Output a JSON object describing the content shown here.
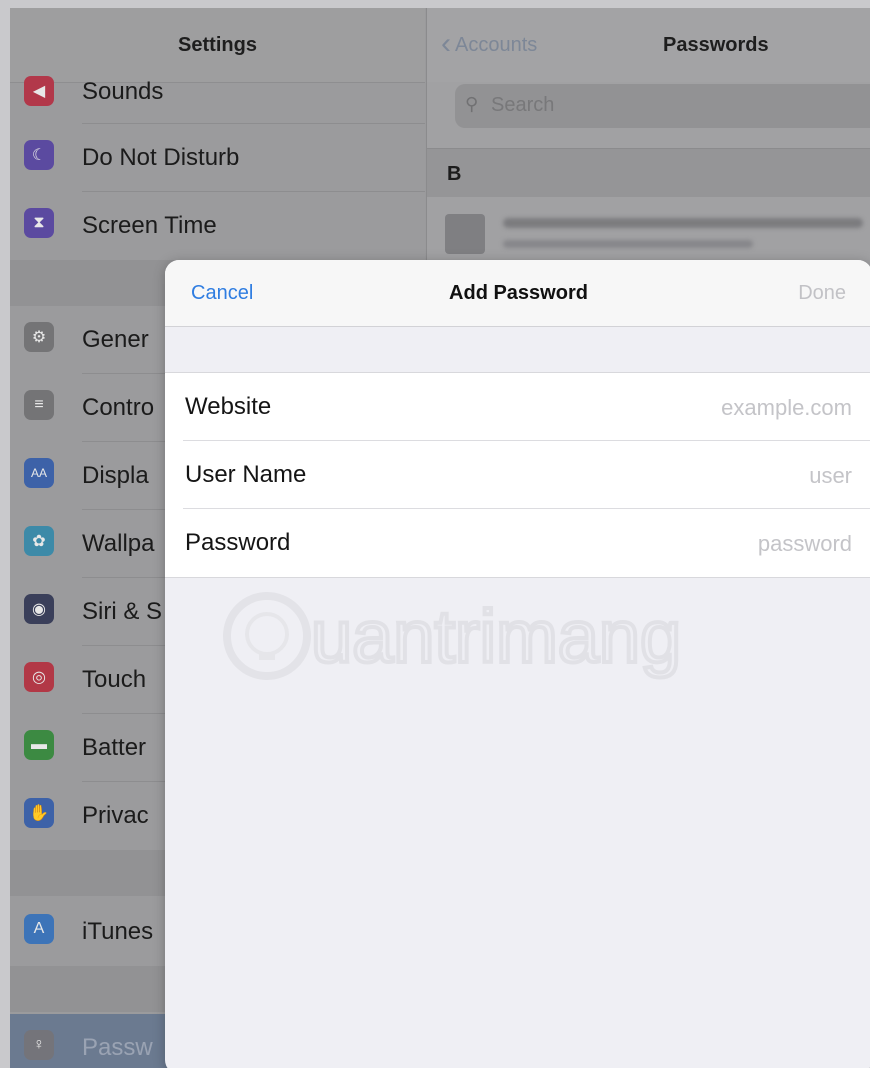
{
  "settings": {
    "title": "Settings",
    "items": [
      {
        "label": "Sounds",
        "icon": "speaker-icon",
        "color": "#b2384a",
        "glyph": "◀"
      },
      {
        "label": "Do Not Disturb",
        "icon": "moon-icon",
        "color": "#5b4aa0",
        "glyph": "☾"
      },
      {
        "label": "Screen Time",
        "icon": "hourglass-icon",
        "color": "#5b4aa0",
        "glyph": "⧗"
      },
      {
        "label": "Gener",
        "icon": "gear-icon",
        "color": "#747476",
        "glyph": "⚙"
      },
      {
        "label": "Contro",
        "icon": "toggles-icon",
        "color": "#747476",
        "glyph": "≡"
      },
      {
        "label": "Displa",
        "icon": "display-icon",
        "color": "#3d62a8",
        "glyph": "AA"
      },
      {
        "label": "Wallpa",
        "icon": "flower-icon",
        "color": "#3d8aa8",
        "glyph": "✿"
      },
      {
        "label": "Siri & S",
        "icon": "siri-icon",
        "color": "#3a3f5a",
        "glyph": "◉"
      },
      {
        "label": "Touch",
        "icon": "fingerprint-icon",
        "color": "#b23846",
        "glyph": "◎"
      },
      {
        "label": "Batter",
        "icon": "battery-icon",
        "color": "#3c8a42",
        "glyph": "▬"
      },
      {
        "label": "Privac",
        "icon": "hand-icon",
        "color": "#3d62a8",
        "glyph": "✋"
      },
      {
        "label": "iTunes",
        "icon": "app-store-icon",
        "color": "#3d74b8",
        "glyph": "A"
      },
      {
        "label": "Passw",
        "icon": "key-icon",
        "color": "#74747a",
        "glyph": "♀"
      }
    ]
  },
  "passwords": {
    "back_label": "Accounts",
    "title": "Passwords",
    "search_placeholder": "Search",
    "section_letter": "B"
  },
  "modal": {
    "cancel_label": "Cancel",
    "title": "Add Password",
    "done_label": "Done",
    "fields": [
      {
        "label": "Website",
        "placeholder": "example.com",
        "value": ""
      },
      {
        "label": "User Name",
        "placeholder": "user",
        "value": ""
      },
      {
        "label": "Password",
        "placeholder": "password",
        "value": ""
      }
    ]
  },
  "watermark": {
    "text": "uantrimang"
  },
  "colors": {
    "accent": "#2f7de1",
    "disabled": "#c2c2c6"
  }
}
